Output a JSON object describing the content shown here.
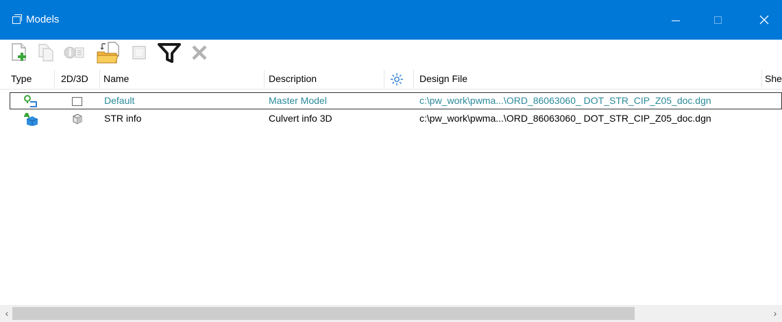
{
  "window": {
    "title": "Models",
    "icon": "window-icon",
    "accent_color": "#0078d7"
  },
  "toolbar": {
    "buttons": [
      {
        "name": "create-model-icon",
        "enabled": true
      },
      {
        "name": "copy-model-icon",
        "enabled": false
      },
      {
        "name": "properties-icon",
        "enabled": false
      },
      {
        "name": "import-model-icon",
        "enabled": true
      },
      {
        "name": "select-all-icon",
        "enabled": false
      },
      {
        "name": "filter-icon",
        "enabled": true
      },
      {
        "name": "delete-icon",
        "enabled": false
      }
    ]
  },
  "table": {
    "columns": {
      "type": "Type",
      "dim": "2D/3D",
      "name": "Name",
      "description": "Description",
      "active": "sun-icon",
      "design_file": "Design File",
      "sheet": "She"
    },
    "rows": [
      {
        "type_icon": "design-model-icon",
        "dim_icon": "2d-model-icon",
        "name": "Default",
        "description": "Master Model",
        "design_file": "c:\\pw_work\\pwma...\\ORD_86063060_ DOT_STR_CIP_Z05_doc.dgn",
        "active": true,
        "text_color": "#2a8a9a"
      },
      {
        "type_icon": "3d-design-model-icon",
        "dim_icon": "3d-model-icon",
        "name": "STR info",
        "description": "Culvert info 3D",
        "design_file": "c:\\pw_work\\pwma...\\ORD_86063060_ DOT_STR_CIP_Z05_doc.dgn",
        "active": false,
        "text_color": "#000000"
      }
    ]
  },
  "scrollbar": {
    "left_arrow": "‹",
    "right_arrow": "›"
  }
}
